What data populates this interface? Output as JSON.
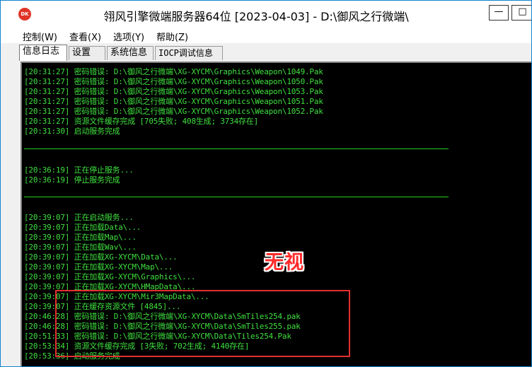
{
  "window": {
    "title": "翎风引擎微端服务器64位 [2023-04-03] - D:\\御风之行微端\\",
    "icon_name": "app-logo-icon",
    "icon_text": "DK",
    "min_label": "—",
    "max_label": "□"
  },
  "menu": [
    {
      "label": "控制(W)"
    },
    {
      "label": "查看(X)"
    },
    {
      "label": "选项(Y)"
    },
    {
      "label": "帮助(Z)"
    }
  ],
  "tabs": [
    {
      "label": "信息日志",
      "active": true
    },
    {
      "label": "设置"
    },
    {
      "label": "系统信息"
    },
    {
      "label": "IOCP调试信息"
    }
  ],
  "log": {
    "lines": [
      "[20:31:27] 密码错误: D:\\御风之行微端\\XG-XYCM\\Graphics\\Weapon\\1049.Pak",
      "[20:31:27] 密码错误: D:\\御风之行微端\\XG-XYCM\\Graphics\\Weapon\\1050.Pak",
      "[20:31:27] 密码错误: D:\\御风之行微端\\XG-XYCM\\Graphics\\Weapon\\1053.Pak",
      "[20:31:27] 密码错误: D:\\御风之行微端\\XG-XYCM\\Graphics\\Weapon\\1051.Pak",
      "[20:31:27] 密码错误: D:\\御风之行微端\\XG-XYCM\\Graphics\\Weapon\\1052.Pak",
      "[20:31:27] 资源文件缓存完成 [705失败; 408生成; 3734存在]",
      "[20:31:30] 启动服务完成",
      "[20:36:19] 正在停止服务...",
      "[20:36:19] 停止服务完成",
      "[20:39:07] 正在启动服务...",
      "[20:39:07] 正在加载Data\\...",
      "[20:39:07] 正在加载Map\\...",
      "[20:39:07] 正在加载Wav\\...",
      "[20:39:07] 正在加载XG-XYCM\\Data\\...",
      "[20:39:07] 正在加载XG-XYCM\\Map\\...",
      "[20:39:07] 正在加载XG-XYCM\\Graphics\\...",
      "[20:39:07] 正在加载XG-XYCM\\HMapData\\...",
      "[20:39:07] 正在加载XG-XYCM\\Mir3MapData\\...",
      "[20:39:07] 正在缓存资源文件 [4845]...",
      "[20:46:28] 密码错误: D:\\御风之行微端\\XG-XYCM\\Data\\SmTiles254.pak",
      "[20:46:28] 密码错误: D:\\御风之行微端\\XG-XYCM\\Data\\SmTiles255.pak",
      "[20:51:33] 密码错误: D:\\御风之行微端\\XG-XYCM\\Data\\Tiles254.Pak",
      "[20:53:34] 资源文件缓存完成 [3失败; 702生成; 4140存在]",
      "[20:53:36] 启动服务完成"
    ]
  },
  "annotation": {
    "label": "无视",
    "color": "#e23030"
  },
  "colors": {
    "log_text": "#3fe03f",
    "log_bg": "#000000",
    "frame": "#1383d0"
  }
}
